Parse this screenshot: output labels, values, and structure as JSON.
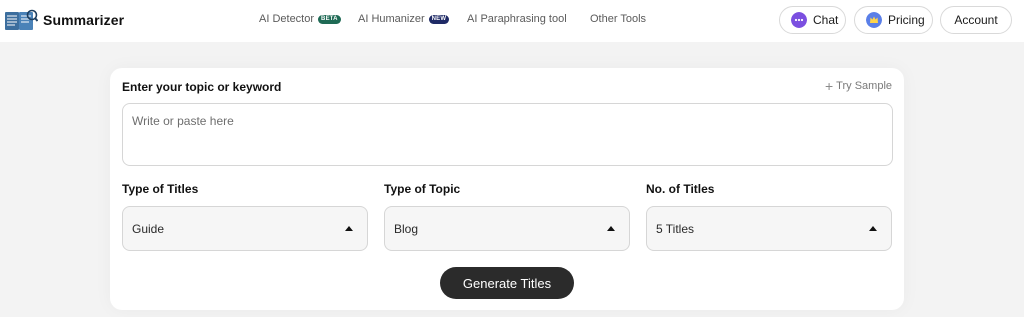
{
  "brand": {
    "name": "Summarizer",
    "logo_icon": "book-reader-logo-icon"
  },
  "nav": {
    "items": [
      {
        "label": "AI Detector",
        "badge": "BETA"
      },
      {
        "label": "AI Humanizer",
        "badge": "NEW"
      },
      {
        "label": "AI Paraphrasing tool"
      },
      {
        "label": "Other Tools"
      }
    ]
  },
  "header_buttons": {
    "chat": {
      "label": "Chat",
      "icon": "chat-bubble-icon"
    },
    "pricing": {
      "label": "Pricing",
      "icon": "crown-icon"
    },
    "account": {
      "label": "Account"
    }
  },
  "form": {
    "topic_label": "Enter your topic or keyword",
    "try_sample_label": "Try Sample",
    "topic_placeholder": "Write or paste here",
    "topic_value": "",
    "fields": [
      {
        "label": "Type of Titles",
        "value": "Guide"
      },
      {
        "label": "Type of Topic",
        "value": "Blog"
      },
      {
        "label": "No. of Titles",
        "value": "5 Titles"
      }
    ],
    "generate_label": "Generate Titles"
  },
  "colors": {
    "page_bg": "#f3f3f3",
    "button_dark": "#2b2b2b",
    "beta_badge": "#1f6a55",
    "new_badge": "#1f2a66",
    "chat_icon": "#7b4fe0",
    "pricing_icon": "#5a7fe8"
  }
}
